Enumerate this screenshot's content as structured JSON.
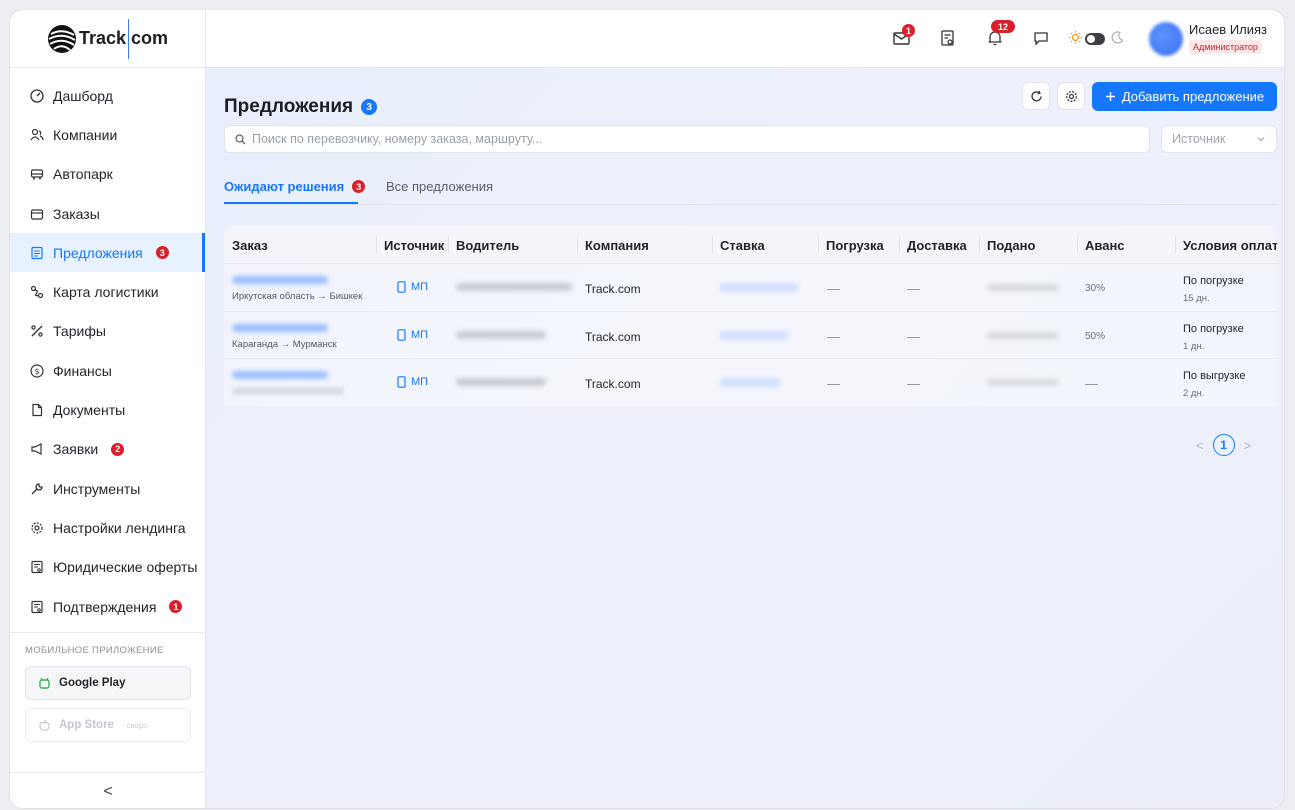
{
  "logo": {
    "text_a": "Track",
    "text_b": "com"
  },
  "sidebar": {
    "items": [
      {
        "label": "Дашборд",
        "icon": "dashboard-icon"
      },
      {
        "label": "Компании",
        "icon": "users-icon"
      },
      {
        "label": "Автопарк",
        "icon": "truck-icon"
      },
      {
        "label": "Заказы",
        "icon": "box-icon"
      },
      {
        "label": "Предложения",
        "icon": "document-icon",
        "badge": "3",
        "active": true
      },
      {
        "label": "Карта логистики",
        "icon": "route-icon"
      },
      {
        "label": "Тарифы",
        "icon": "percent-icon"
      },
      {
        "label": "Финансы",
        "icon": "dollar-icon"
      },
      {
        "label": "Документы",
        "icon": "file-icon"
      },
      {
        "label": "Заявки",
        "icon": "megaphone-icon",
        "badge": "2"
      },
      {
        "label": "Инструменты",
        "icon": "wrench-icon"
      },
      {
        "label": "Настройки лендинга",
        "icon": "gear-icon"
      },
      {
        "label": "Юридические оферты",
        "icon": "contract-icon"
      },
      {
        "label": "Подтверждения",
        "icon": "check-document-icon",
        "badge": "1"
      }
    ],
    "mobile_title": "МОБИЛЬНОЕ ПРИЛОЖЕНИЕ",
    "google_play": "Google Play",
    "app_store": "App Store",
    "app_store_soon": "· скоро",
    "collapse": "<"
  },
  "header": {
    "mail_badge": "1",
    "bell_badge": "12",
    "user_name": "Исаев Илияз",
    "user_role": "Администратор"
  },
  "main": {
    "title": "Предложения",
    "title_count": "3",
    "add_button": "Добавить предложение",
    "search_placeholder": "Поиск по перевозчику, номеру заказа, маршруту...",
    "source_select": "Источник",
    "tabs": [
      {
        "label": "Ожидают решения",
        "badge": "3",
        "active": true
      },
      {
        "label": "Все предложения"
      }
    ],
    "columns": [
      "Заказ",
      "Источник",
      "Водитель",
      "Компания",
      "Ставка",
      "Погрузка",
      "Доставка",
      "Подано",
      "Аванс",
      "Условия оплаты"
    ],
    "rows": [
      {
        "route": "Иркутская область → Бишкек",
        "source": "МП",
        "company": "Track.com",
        "loading": "—",
        "delivery": "—",
        "advance": "30%",
        "terms": "По погрузке",
        "terms_days": "15 дн."
      },
      {
        "route": "Караганда → Мурманск",
        "source": "МП",
        "company": "Track.com",
        "loading": "—",
        "delivery": "—",
        "advance": "50%",
        "terms": "По погрузке",
        "terms_days": "1 дн."
      },
      {
        "route": "",
        "source": "МП",
        "company": "Track.com",
        "loading": "—",
        "delivery": "—",
        "advance": "—",
        "terms": "По выгрузке",
        "terms_days": "2 дн."
      }
    ],
    "pager": {
      "prev": "<",
      "current": "1",
      "next": ">"
    }
  },
  "colors": {
    "accent": "#1677ff",
    "badge": "#d9202a",
    "active_bg": "#e8f1ff"
  }
}
